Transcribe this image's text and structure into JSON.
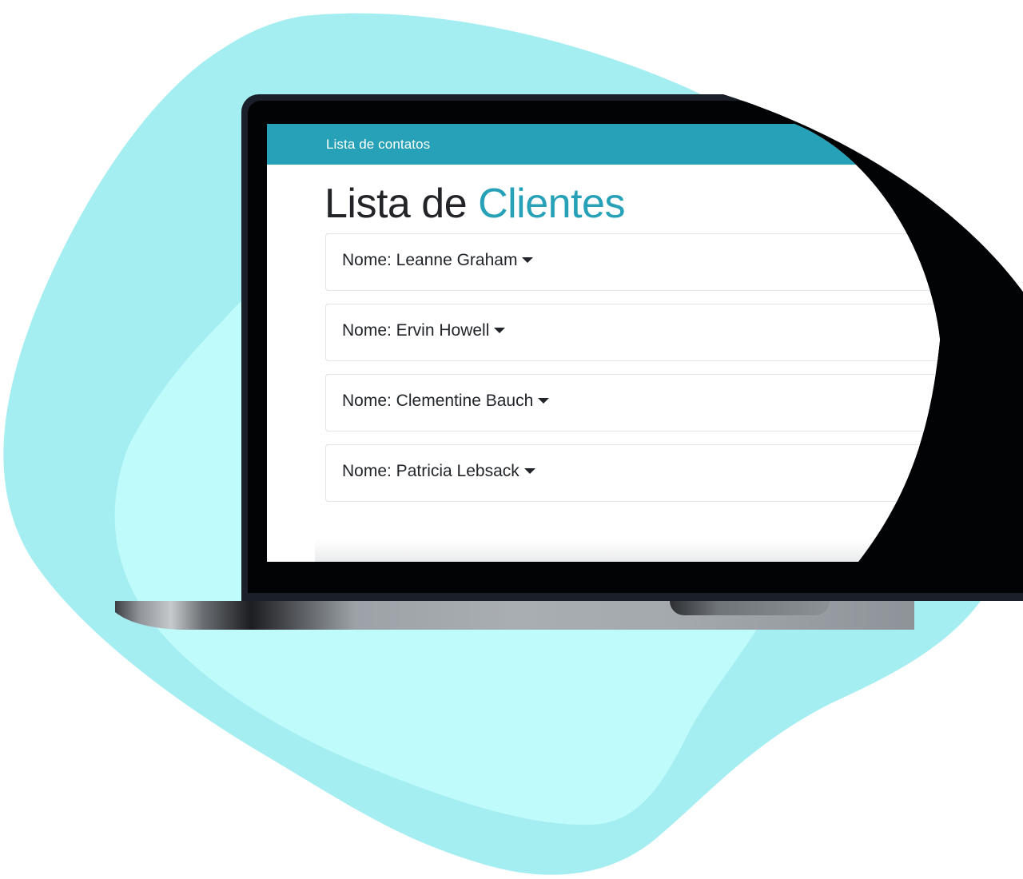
{
  "colors": {
    "accent": "#26a1b7",
    "blob_outer": "#a4eef2",
    "blob_inner": "#bffbfb",
    "text": "#212529"
  },
  "navbar": {
    "brand": "Lista de contatos"
  },
  "header": {
    "title_prefix": "Lista de ",
    "title_accent": "Clientes"
  },
  "clients": [
    {
      "label": "Nome: Leanne Graham"
    },
    {
      "label": "Nome: Ervin Howell"
    },
    {
      "label": "Nome: Clementine Bauch"
    },
    {
      "label": "Nome: Patricia Lebsack"
    }
  ],
  "icons": {
    "caret": "caret-down-icon"
  }
}
